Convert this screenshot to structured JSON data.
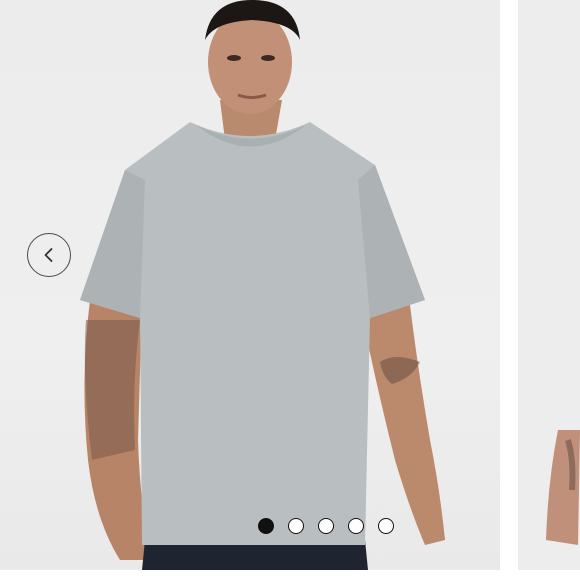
{
  "carousel": {
    "prev_icon": "chevron-left-icon",
    "slide_count": 5,
    "active_slide": 1,
    "dots": [
      {
        "active": true
      },
      {
        "active": false
      },
      {
        "active": false
      },
      {
        "active": false
      },
      {
        "active": false
      }
    ]
  },
  "colors": {
    "background": "#efefef",
    "tshirt": "#b9bfc1",
    "dot_active": "#111111",
    "control_border": "#4a4a4a"
  }
}
